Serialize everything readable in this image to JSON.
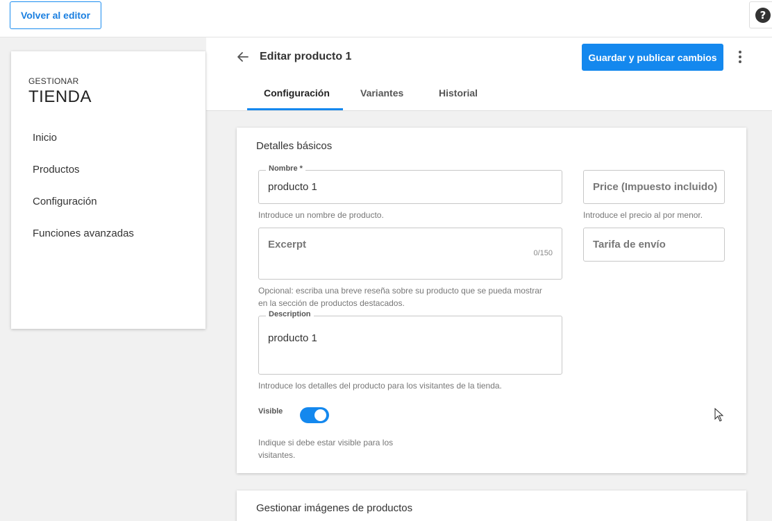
{
  "topbar": {
    "back_button": "Volver al editor",
    "help_icon": "help-icon",
    "help_symbol": "?"
  },
  "sidebar": {
    "subtitle": "GESTIONAR",
    "title": "TIENDA",
    "items": [
      {
        "label": "Inicio"
      },
      {
        "label": "Productos"
      },
      {
        "label": "Configuración"
      },
      {
        "label": "Funciones avanzadas"
      }
    ]
  },
  "header": {
    "title": "Editar producto 1",
    "publish_button": "Guardar y publicar cambios",
    "back_icon": "arrow-left-icon",
    "more_icon": "more-vertical-icon"
  },
  "tabs": [
    {
      "label": "Configuración",
      "active": true
    },
    {
      "label": "Variantes",
      "active": false
    },
    {
      "label": "Historial",
      "active": false
    }
  ],
  "basic_details": {
    "title": "Detalles básicos",
    "name": {
      "label": "Nombre *",
      "value": "producto 1",
      "helper": "Introduce un nombre de producto."
    },
    "price": {
      "placeholder": "Price (Impuesto incluido)",
      "helper": "Introduce el precio al por menor."
    },
    "excerpt": {
      "placeholder": "Excerpt",
      "counter": "0/150",
      "helper_line1": "Opcional: escriba una breve reseña sobre su producto que se pueda mostrar",
      "helper_line2": "en la sección de productos destacados."
    },
    "shipping": {
      "placeholder": "Tarifa de envío"
    },
    "description": {
      "label": "Description",
      "value": "producto 1",
      "helper": "Introduce los detalles del producto para los visitantes de la tienda."
    },
    "visible": {
      "label": "Visible",
      "on": true,
      "helper_line1": "Indique si debe estar visible para los",
      "helper_line2": "visitantes."
    }
  },
  "images_section": {
    "title": "Gestionar imágenes de productos"
  },
  "colors": {
    "accent": "#1488ee",
    "background": "#f1f1f1"
  }
}
